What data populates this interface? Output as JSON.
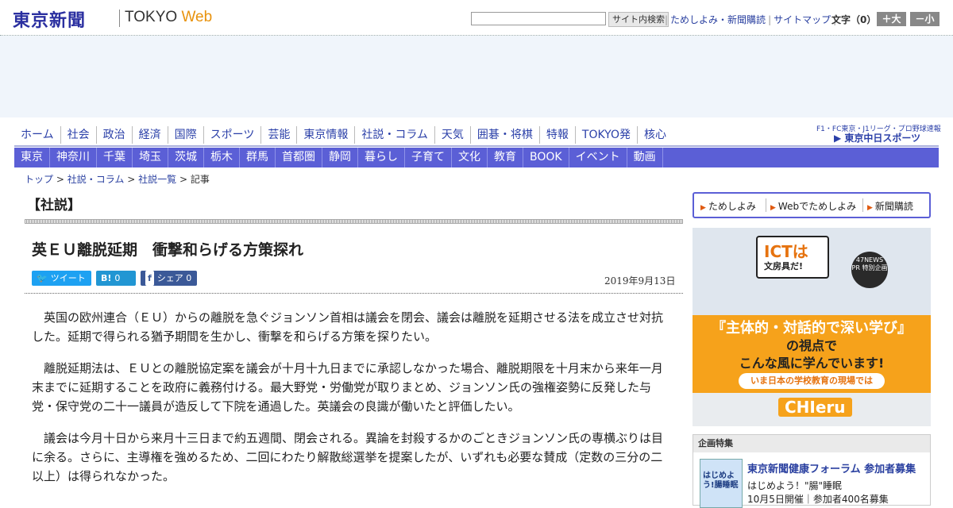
{
  "header": {
    "logo": "東京新聞",
    "tokyo_web": "TOKYO",
    "tokyo_web_accent": "Web",
    "search_placeholder": "",
    "search_button": "サイト内検索",
    "links": [
      "ためしよみ・新聞購読",
      "サイトマップ"
    ],
    "font_size_label": "文字（0）",
    "font_bigger": "＋大",
    "font_smaller": "－小"
  },
  "nav_main": [
    "ホーム",
    "社会",
    "政治",
    "経済",
    "国際",
    "スポーツ",
    "芸能",
    "東京情報",
    "社説・コラム",
    "天気",
    "囲碁・将棋",
    "特報",
    "TOKYO発",
    "核心"
  ],
  "chuspo": {
    "small": "F1・FC東京・J1リーグ・プロ野球速報",
    "brand": "東京中日スポーツ"
  },
  "nav_sub": [
    "東京",
    "神奈川",
    "千葉",
    "埼玉",
    "茨城",
    "栃木",
    "群馬",
    "首都圏",
    "静岡",
    "暮らし",
    "子育て",
    "文化",
    "教育",
    "BOOK",
    "イベント",
    "動画"
  ],
  "breadcrumb": {
    "items": [
      "トップ",
      "社説・コラム",
      "社説一覧"
    ],
    "current": "記事",
    "sep": ">"
  },
  "section_title": "【社説】",
  "article": {
    "headline": "英ＥＵ離脱延期　衝撃和らげる方策探れ",
    "date": "2019年9月13日",
    "share": {
      "tweet": "ツイート",
      "hatena_icon": "B!",
      "hatena_count": "0",
      "fb_icon": "f",
      "fb_label": "シェア",
      "fb_count": "0"
    },
    "paragraphs": [
      "英国の欧州連合（ＥＵ）からの離脱を急ぐジョンソン首相は議会を閉会、議会は離脱を延期させる法を成立させ対抗した。延期で得られる猶予期間を生かし、衝撃を和らげる方策を探りたい。",
      "離脱延期法は、ＥＵとの離脱協定案を議会が十月十九日までに承認しなかった場合、離脱期限を十月末から来年一月末までに延期することを政府に義務付ける。最大野党・労働党が取りまとめ、ジョンソン氏の強権姿勢に反発した与党・保守党の二十一議員が造反して下院を通過した。英議会の良識が働いたと評価したい。",
      "議会は今月十日から来月十三日まで約五週間、閉会される。異論を封殺するかのごときジョンソン氏の専横ぶりは目に余る。さらに、主導権を強めるため、二回にわたり解散総選挙を提案したが、いずれも必要な賛成（定数の三分の二以上）は得られなかった。"
    ]
  },
  "sidebar": {
    "subscribe_links": [
      "ためしよみ",
      "Webでためしよみ",
      "新聞購読"
    ],
    "banner": {
      "ict_title": "ICTは",
      "ict_sub": "文房具だ!",
      "badge": "47NEWS PR 特別企画",
      "headline": "『主体的・対話的で深い学び』",
      "sub1": "の視点で",
      "sub2": "こんな風に学んでいます!",
      "tag": "いま日本の学校教育の現場では",
      "brand": "CHIeru"
    },
    "kikaku": {
      "heading": "企画特集",
      "thumb_text": "はじめよう!腸睡眠",
      "title": "東京新聞健康フォーラム 参加者募集",
      "desc": "はじめよう！\"腸\"睡眠",
      "desc2": "10月5日開催｜参加者400名募集"
    }
  },
  "colors": {
    "brand_blue": "#2a2fa0",
    "nav_blue": "#5b5fd6",
    "web_orange": "#e8920c",
    "twitter": "#1da1f2",
    "hatena": "#2196d3",
    "facebook": "#3b5998",
    "banner_orange": "#f6a21b"
  }
}
